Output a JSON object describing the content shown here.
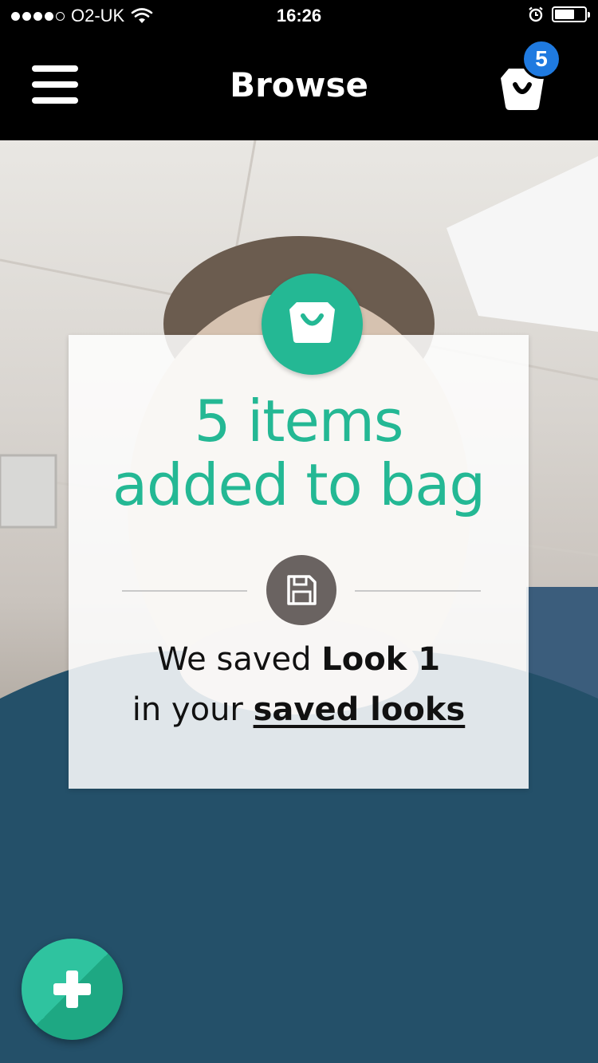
{
  "status_bar": {
    "carrier": "O2-UK",
    "time": "16:26"
  },
  "nav": {
    "title": "Browse",
    "bag_count": "5"
  },
  "confirmation": {
    "headline_line1": "5 items",
    "headline_line2": "added to bag",
    "saved_prefix": "We saved ",
    "look_name": "Look 1",
    "saved_in": "in your ",
    "saved_link": "saved looks"
  },
  "colors": {
    "accent_green": "#24b894",
    "badge_blue": "#1f7ae0",
    "save_icon_bg": "#6a6361"
  },
  "icons": {
    "menu": "hamburger-icon",
    "bag": "shopping-bag-icon",
    "save": "floppy-disk-icon",
    "add": "plus-icon"
  }
}
